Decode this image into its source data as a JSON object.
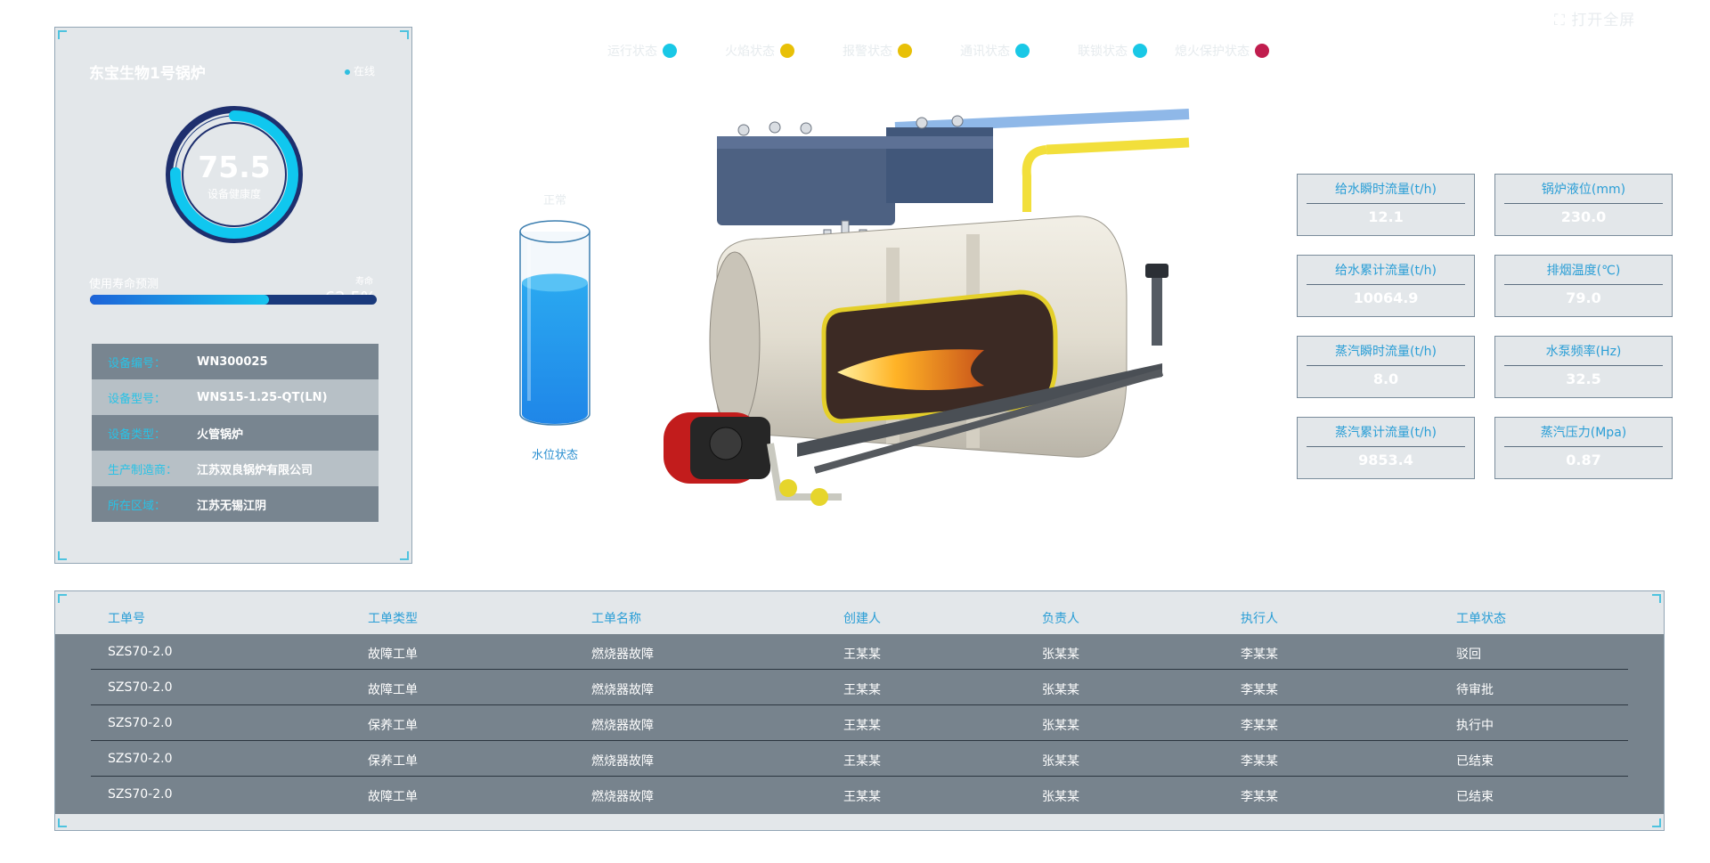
{
  "top_right": "打开全屏",
  "status_indicators": [
    {
      "label": "运行状态",
      "color": "#19c8e6"
    },
    {
      "label": "火焰状态",
      "color": "#e8c007"
    },
    {
      "label": "报警状态",
      "color": "#e8c007"
    },
    {
      "label": "通讯状态",
      "color": "#19c8e6"
    },
    {
      "label": "联锁状态",
      "color": "#19c8e6"
    },
    {
      "label": "熄火保护状态",
      "color": "#c01d4e"
    }
  ],
  "panel": {
    "title": "东宝生物1号锅炉",
    "online": "在线",
    "health_value": "75.5",
    "health_label": "设备健康度",
    "health_fraction": 0.755,
    "life_label": "使用寿命预测",
    "life_prefix": "寿命",
    "life_value": "62.5%",
    "life_fraction": 0.625,
    "info": [
      {
        "key": "设备编号：",
        "value": "WN300025"
      },
      {
        "key": "设备型号：",
        "value": "WNS15-1.25-QT(LN)"
      },
      {
        "key": "设备类型：",
        "value": "火管锅炉"
      },
      {
        "key": "生产制造商：",
        "value": "江苏双良锅炉有限公司"
      },
      {
        "key": "所在区域：",
        "value": "江苏无锡江阴"
      }
    ]
  },
  "tank": {
    "top_label": "正常",
    "caption": "水位状态",
    "level_fraction": 0.72
  },
  "metrics": [
    {
      "label": "给水瞬时流量(t/h)",
      "value": "12.1"
    },
    {
      "label": "锅炉液位(mm)",
      "value": "230.0"
    },
    {
      "label": "给水累计流量(t/h)",
      "value": "10064.9"
    },
    {
      "label": "排烟温度(℃)",
      "value": "79.0"
    },
    {
      "label": "蒸汽瞬时流量(t/h)",
      "value": "8.0"
    },
    {
      "label": "水泵频率(Hz)",
      "value": "32.5"
    },
    {
      "label": "蒸汽累计流量(t/h)",
      "value": "9853.4"
    },
    {
      "label": "蒸汽压力(Mpa)",
      "value": "0.87"
    }
  ],
  "orders": {
    "columns": [
      "工单号",
      "工单类型",
      "工单名称",
      "创建人",
      "负责人",
      "执行人",
      "工单状态"
    ],
    "rows": [
      [
        "SZS70-2.0",
        "故障工单",
        "燃烧器故障",
        "王某某",
        "张某某",
        "李某某",
        "驳回"
      ],
      [
        "SZS70-2.0",
        "故障工单",
        "燃烧器故障",
        "王某某",
        "张某某",
        "李某某",
        "待审批"
      ],
      [
        "SZS70-2.0",
        "保养工单",
        "燃烧器故障",
        "王某某",
        "张某某",
        "李某某",
        "执行中"
      ],
      [
        "SZS70-2.0",
        "保养工单",
        "燃烧器故障",
        "王某某",
        "张某某",
        "李某某",
        "已结束"
      ],
      [
        "SZS70-2.0",
        "故障工单",
        "燃烧器故障",
        "王某某",
        "张某某",
        "李某某",
        "已结束"
      ]
    ]
  }
}
